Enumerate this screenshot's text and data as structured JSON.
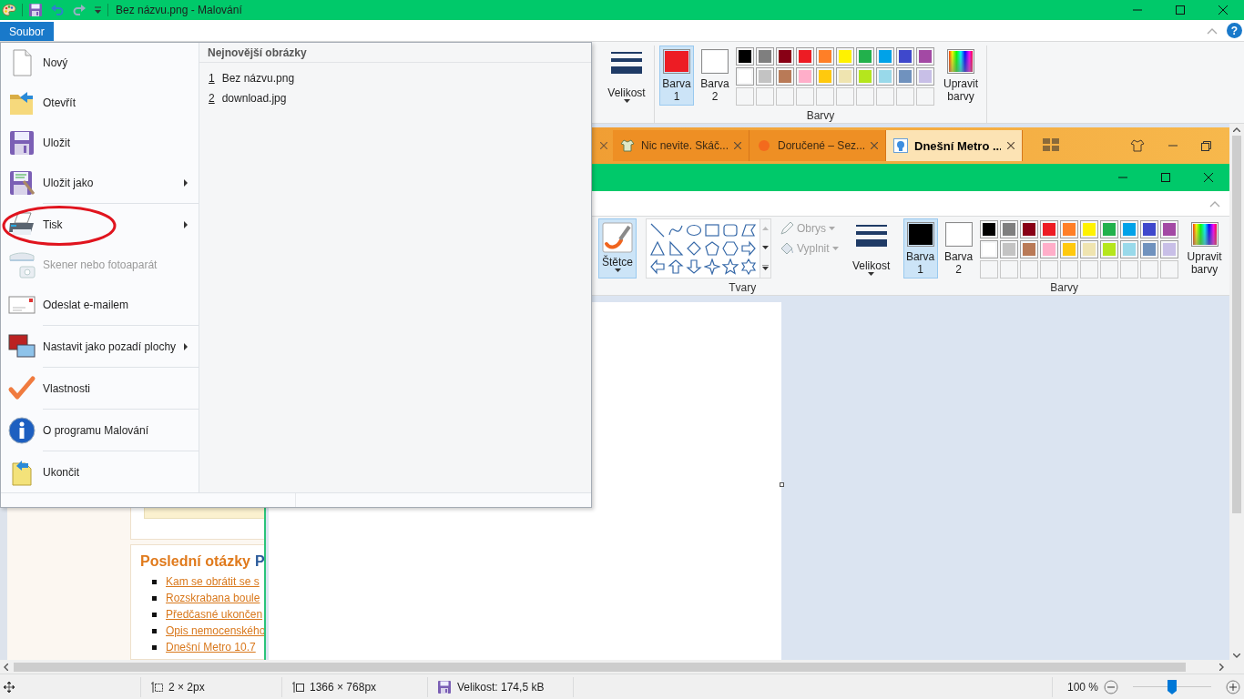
{
  "title_bar": {
    "title": "Bez názvu.png - Malování"
  },
  "tabs": {
    "file_tab": {
      "label": "Soubor",
      "selected": true
    },
    "help": "?"
  },
  "file_menu": {
    "groups": [
      [
        {
          "label": "Nový",
          "submenu": false,
          "disabled": false,
          "circled": false
        },
        {
          "label": "Otevřít",
          "submenu": false,
          "disabled": false,
          "circled": false
        },
        {
          "label": "Uložit",
          "submenu": false,
          "disabled": false,
          "circled": false
        },
        {
          "label": "Uložit jako",
          "submenu": true,
          "disabled": false,
          "circled": false
        }
      ],
      [
        {
          "label": "Tisk",
          "submenu": true,
          "disabled": false,
          "circled": true
        },
        {
          "label": "Skener nebo fotoaparát",
          "submenu": false,
          "disabled": true,
          "circled": false
        },
        {
          "label": "Odeslat e-mailem",
          "submenu": false,
          "disabled": false,
          "circled": false
        }
      ],
      [
        {
          "label": "Nastavit jako pozadí plochy",
          "submenu": true,
          "disabled": false,
          "circled": false
        }
      ],
      [
        {
          "label": "Vlastnosti",
          "submenu": false,
          "disabled": false,
          "circled": false
        }
      ],
      [
        {
          "label": "O programu Malování",
          "submenu": false,
          "disabled": false,
          "circled": false
        }
      ],
      [
        {
          "label": "Ukončit",
          "submenu": false,
          "disabled": false,
          "circled": false
        }
      ]
    ],
    "recent_heading": "Nejnovější obrázky",
    "recent": [
      {
        "number": "1",
        "name": "Bez názvu.png"
      },
      {
        "number": "2",
        "name": "download.jpg"
      }
    ]
  },
  "ribbon": {
    "size": {
      "label": "Velikost"
    },
    "colors": {
      "color1": {
        "label": "Barva 1",
        "color": "#ed1c24",
        "selected": true
      },
      "color2": {
        "label": "Barva 2",
        "color": "#ffffff",
        "selected": false
      },
      "palette": [
        {
          "color": "#000000"
        },
        {
          "color": "#7f7f7f"
        },
        {
          "color": "#880015"
        },
        {
          "color": "#ed1c24"
        },
        {
          "color": "#ff7f27"
        },
        {
          "color": "#fff200"
        },
        {
          "color": "#22b14c"
        },
        {
          "color": "#00a2e8"
        },
        {
          "color": "#3f48cc"
        },
        {
          "color": "#a349a4"
        },
        {
          "color": "#ffffff"
        },
        {
          "color": "#c3c3c3"
        },
        {
          "color": "#b97a57"
        },
        {
          "color": "#ffaec9"
        },
        {
          "color": "#ffc90e"
        },
        {
          "color": "#efe4b0"
        },
        {
          "color": "#b5e61d"
        },
        {
          "color": "#99d9ea"
        },
        {
          "color": "#7092be"
        },
        {
          "color": "#c8bfe7"
        }
      ],
      "edit_label": "Upravit barvy",
      "group_label": "Barvy"
    }
  },
  "screenshot": {
    "browser_tabs": [
      {
        "label": "Nic nevite. Skáč...",
        "selected": false
      },
      {
        "label": "Doručené – Sez...",
        "selected": false
      },
      {
        "label": "Dnešní Metro ...",
        "selected": true
      }
    ],
    "inner_ribbon": {
      "brushes": {
        "label": "Štětce",
        "selected": true
      },
      "outline": {
        "label": "Obrys",
        "disabled": true
      },
      "fill": {
        "label": "Vyplnit",
        "disabled": true
      },
      "shapes_label": "Tvary",
      "size": {
        "label": "Velikost"
      },
      "colors": {
        "color1": {
          "label": "Barva 1",
          "color": "#000000",
          "selected": true
        },
        "color2": {
          "label": "Barva 2",
          "color": "#ffffff",
          "selected": false
        },
        "palette": [
          {
            "color": "#000000"
          },
          {
            "color": "#7f7f7f"
          },
          {
            "color": "#880015"
          },
          {
            "color": "#ed1c24"
          },
          {
            "color": "#ff7f27"
          },
          {
            "color": "#fff200"
          },
          {
            "color": "#22b14c"
          },
          {
            "color": "#00a2e8"
          },
          {
            "color": "#3f48cc"
          },
          {
            "color": "#a349a4"
          },
          {
            "color": "#ffffff"
          },
          {
            "color": "#c3c3c3"
          },
          {
            "color": "#b97a57"
          },
          {
            "color": "#ffaec9"
          },
          {
            "color": "#ffc90e"
          },
          {
            "color": "#efe4b0"
          },
          {
            "color": "#b5e61d"
          },
          {
            "color": "#99d9ea"
          },
          {
            "color": "#7092be"
          },
          {
            "color": "#c8bfe7"
          }
        ],
        "edit_label": "Upravit barvy",
        "group_label": "Barvy"
      }
    },
    "web_page": {
      "heading": "Poslední otázky",
      "heading_tail": "P",
      "links": [
        "Kam se obrátit se s",
        "Rozskrabana boule",
        "Předčasné ukončen",
        "Opis nemocenského",
        "Dnešní Metro 10.7"
      ]
    }
  },
  "status_bar": {
    "selection": "2 × 2px",
    "canvas_size": "1366 × 768px",
    "file_size": "Velikost: 174,5 kB",
    "zoom": "100 %",
    "zoom_slider": {
      "level": 0.5
    }
  }
}
